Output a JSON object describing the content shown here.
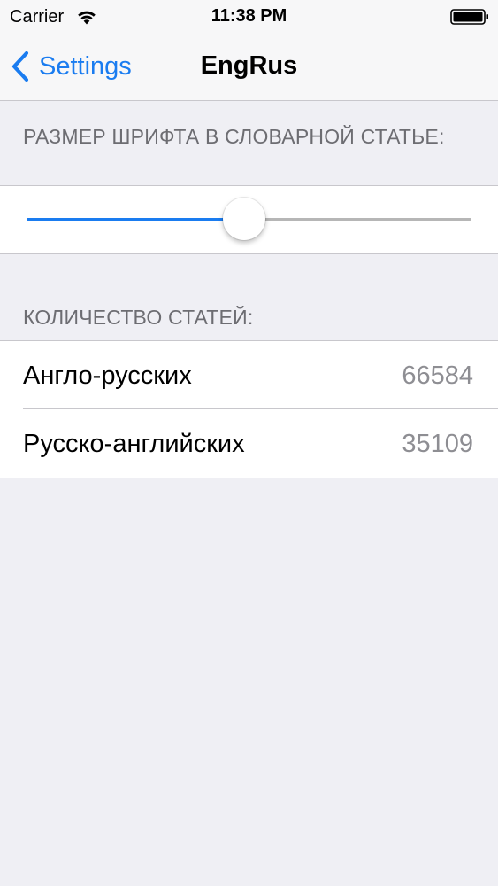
{
  "status_bar": {
    "carrier": "Carrier",
    "time": "11:38 PM",
    "wifi_icon": "wifi-icon",
    "battery_icon": "battery-full-icon"
  },
  "nav": {
    "back_label": "Settings",
    "back_icon": "chevron-left-icon",
    "title": "EngRus"
  },
  "font_size_section": {
    "header": "РАЗМЕР ШРИФТА В СЛОВАРНОЙ СТАТЬЕ:",
    "slider_value": 0.49
  },
  "count_section": {
    "header": "КОЛИЧЕСТВО СТАТЕЙ:",
    "rows": [
      {
        "label": "Англо-русских",
        "value": "66584"
      },
      {
        "label": "Русско-английских",
        "value": "35109"
      }
    ]
  },
  "colors": {
    "accent": "#1a7cf0",
    "background": "#efeff4",
    "section_header": "#6d6d72",
    "secondary_value": "#8e8e93"
  }
}
